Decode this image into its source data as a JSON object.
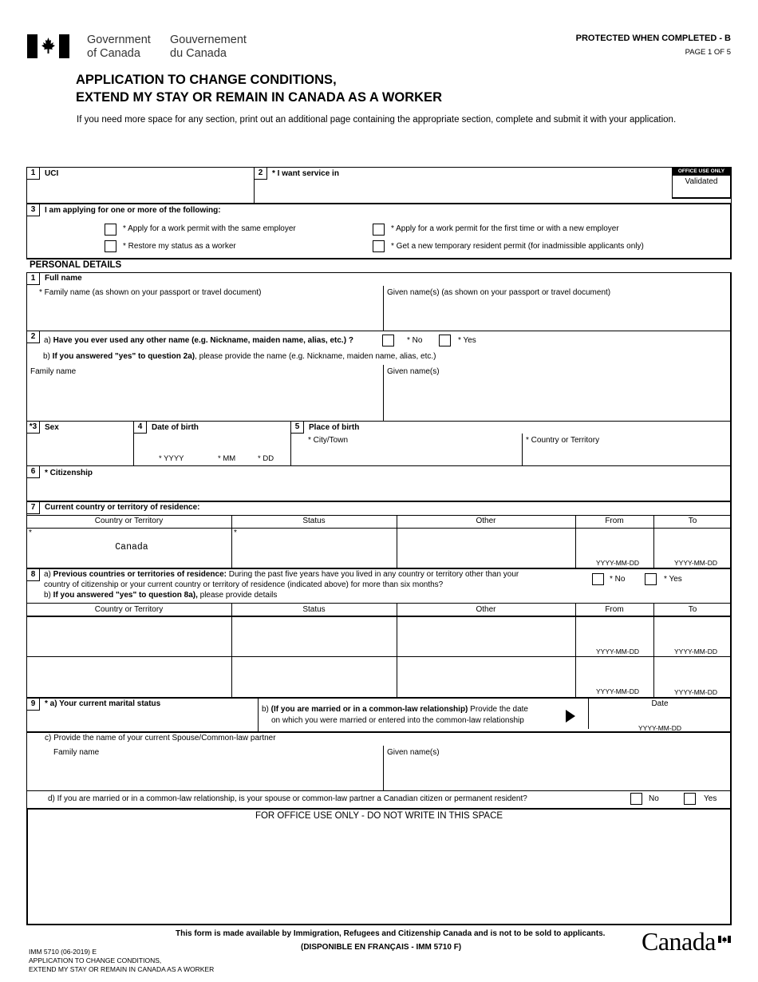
{
  "header": {
    "gov_en_line1": "Government",
    "gov_en_line2": "of Canada",
    "gov_fr_line1": "Gouvernement",
    "gov_fr_line2": "du Canada",
    "protected": "PROTECTED WHEN COMPLETED - B",
    "page": "PAGE 1 OF 5",
    "title_line1": "APPLICATION TO CHANGE CONDITIONS,",
    "title_line2": "EXTEND MY STAY OR REMAIN IN CANADA AS A WORKER",
    "instructions": "If you need more space for any section, print out an additional page containing the appropriate section, complete and submit it with your application."
  },
  "top": {
    "q1_num": "1",
    "q1_label": "UCI",
    "q1_value": "",
    "q2_num": "2",
    "q2_label": "* I want service in",
    "q2_value": "",
    "office_use_label": "OFFICE USE ONLY",
    "office_validated": "Validated",
    "q3_num": "3",
    "q3_label": "I am applying for one or more of the following:",
    "options": [
      {
        "label": "* Apply for a work permit with the same employer",
        "checked": false
      },
      {
        "label": "*  Restore my status as a worker",
        "checked": false
      },
      {
        "label": "* Apply for a work permit for the first time or with a new employer",
        "checked": false
      },
      {
        "label": "* Get a new temporary resident permit (for inadmissible applicants only)",
        "checked": false
      }
    ]
  },
  "personal": {
    "section_title": "PERSONAL DETAILS",
    "q1_num": "1",
    "q1_label": "Full name",
    "family_label": "* Family name (as shown on your passport or travel document)",
    "given_label": "Given name(s) (as shown on your passport or travel document)",
    "family_value": "",
    "given_value": "",
    "q2_num": "2",
    "q2a_prefix": "a) ",
    "q2a_bold": "Have you ever used any other name (e.g. Nickname, maiden name, alias, etc.) ?",
    "no_label": "* No",
    "yes_label": "* Yes",
    "q2b_prefix": "b) ",
    "q2b_bold": "If you answered \"yes\" to question 2a)",
    "q2b_rest": ", please provide the name (e.g. Nickname, maiden name, alias, etc.)",
    "other_family_label": "Family name",
    "other_given_label": "Given name(s)",
    "q3_num": "*3",
    "q3_label": "Sex",
    "q4_num": "4",
    "q4_label": "Date of birth",
    "dob_yyyy": "* YYYY",
    "dob_mm": "* MM",
    "dob_dd": "* DD",
    "q5_num": "5",
    "q5_label": "Place of birth",
    "city_label": "* City/Town",
    "country_label": "* Country or Territory",
    "q6_num": "6",
    "q6_label": "* Citizenship",
    "q7_num": "7",
    "q7_label": "Current country or territory of residence:",
    "table_headers": [
      "Country or Territory",
      "Status",
      "Other",
      "From",
      "To"
    ],
    "current_residence": {
      "country": "Canada",
      "status": "",
      "other": "",
      "from_format": "YYYY-MM-DD",
      "to_format": "YYYY-MM-DD",
      "required_mark": "*"
    },
    "q8_num": "8",
    "q8a_prefix": "a) ",
    "q8a_bold": "Previous countries or territories of residence:",
    "q8a_rest1": " During the past five years have you lived in any country or territory other than your",
    "q8a_rest2": "country of citizenship or your current country or territory of residence (indicated above) for more than six months?",
    "q8b_prefix": "b) ",
    "q8b_bold": "If you answered \"yes\" to question 8a),",
    "q8b_rest": " please provide details",
    "previous_rows": [
      {
        "from_format": "YYYY-MM-DD",
        "to_format": "YYYY-MM-DD"
      },
      {
        "from_format": "YYYY-MM-DD",
        "to_format": "YYYY-MM-DD"
      }
    ],
    "q9_num": "9",
    "q9a_label": "* a) Your current marital status",
    "q9b_prefix": "b) ",
    "q9b_bold": "(If you are married or in a common-law relationship)",
    "q9b_rest1": " Provide the date",
    "q9b_rest2": "on which you were married or entered into the common-law relationship",
    "date_label": "Date",
    "date_format": "YYYY-MM-DD",
    "q9c_label": "c) Provide the name of your current Spouse/Common-law partner",
    "spouse_family_label": "Family name",
    "spouse_given_label": "Given name(s)",
    "q9d_label": "d)  If you are married or in a common-law relationship, is your spouse or common-law partner a Canadian citizen or permanent resident?",
    "q9d_no": "No",
    "q9d_yes": "Yes"
  },
  "office": {
    "label": "FOR OFFICE USE ONLY - DO NOT WRITE IN THIS SPACE"
  },
  "footer": {
    "notice": "This form is made available by Immigration, Refugees and Citizenship Canada and is not to be sold to applicants.",
    "french": "(DISPONIBLE EN FRANÇAIS - IMM 5710 F)",
    "form_code": "IMM 5710 (06-2019) E",
    "form_title1": "APPLICATION TO CHANGE CONDITIONS,",
    "form_title2": "EXTEND MY STAY OR REMAIN IN CANADA AS A WORKER",
    "wordmark": "Canada"
  }
}
